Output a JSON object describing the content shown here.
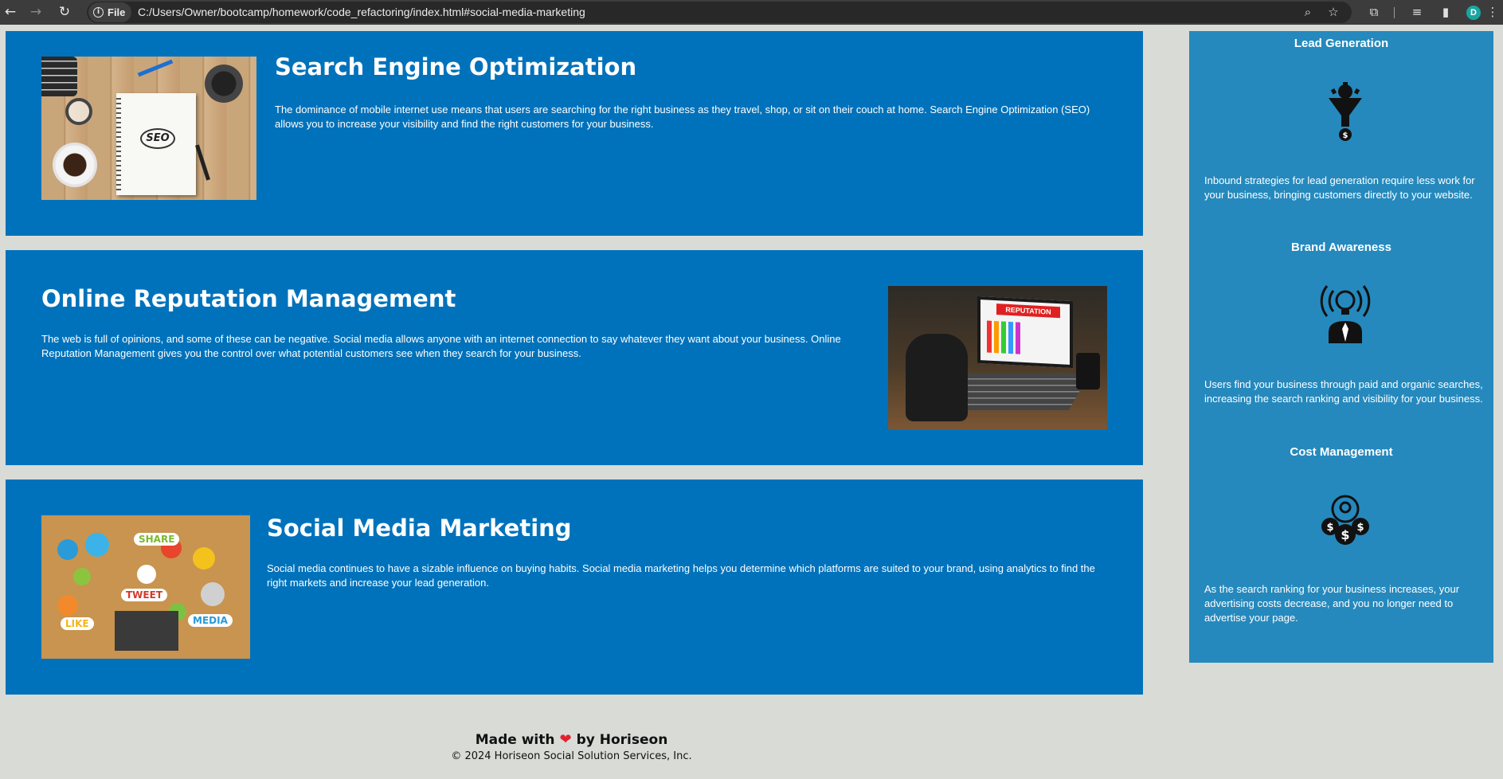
{
  "browser": {
    "chip_label": "File",
    "url": "C:/Users/Owner/bootcamp/homework/code_refactoring/index.html#social-media-marketing",
    "profile_initial": "D"
  },
  "sections": [
    {
      "title": "Search Engine Optimization",
      "text": "The dominance of mobile internet use means that users are searching for the right business as they travel, shop, or sit on their couch at home. Search Engine Optimization (SEO) allows you to increase your visibility and find the right customers for your business.",
      "image_label": "SEO"
    },
    {
      "title": "Online Reputation Management",
      "text": "The web is full of opinions, and some of these can be negative. Social media allows anyone with an internet connection to say whatever they want about your business. Online Reputation Management gives you the control over what potential customers see when they search for your business.",
      "image_label": "REPUTATION"
    },
    {
      "title": "Social Media Marketing",
      "text": "Social media continues to have a sizable influence on buying habits. Social media marketing helps you determine which platforms are suited to your brand, using analytics to find the right markets and increase your lead generation.",
      "image_labels": [
        "SHARE",
        "TWEET",
        "LIKE",
        "MEDIA"
      ]
    }
  ],
  "benefits": [
    {
      "title": "Lead Generation",
      "text": "Inbound strategies for lead generation require less work for your business, bringing customers directly to your website.",
      "icon": "lead-generation-icon"
    },
    {
      "title": "Brand Awareness",
      "text": "Users find your business through paid and organic searches, increasing the search ranking and visibility for your business.",
      "icon": "brand-awareness-icon"
    },
    {
      "title": "Cost Management",
      "text": "As the search ranking for your business increases, your advertising costs decrease, and you no longer need to advertise your page.",
      "icon": "cost-management-icon"
    }
  ],
  "footer": {
    "made_prefix": "Made with",
    "heart": "❤",
    "made_suffix": "by Horiseon",
    "copyright": "© 2024 Horiseon Social Solution Services, Inc."
  },
  "colors": {
    "section_bg": "#0072bb",
    "sidebar_bg": "#2589bd",
    "page_bg": "#d9dbd7",
    "heart": "#e5202e"
  }
}
